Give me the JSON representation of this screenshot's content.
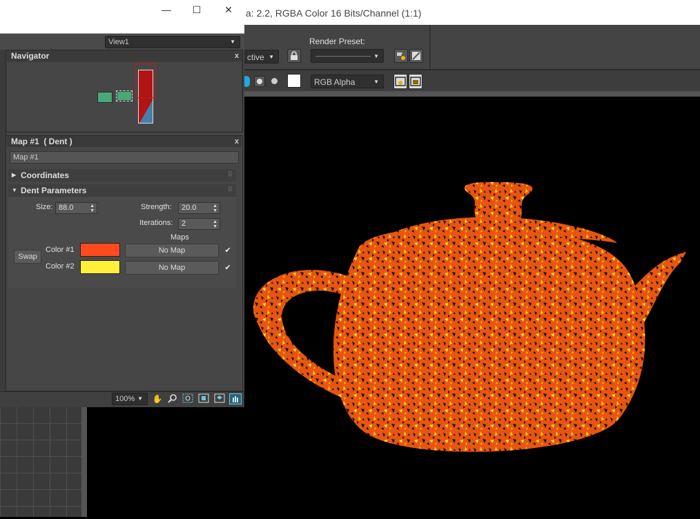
{
  "render_frame": {
    "title_fragment": "a: 2.2, RGBA Color 16 Bits/Channel (1:1)",
    "render_preset_label": "Render Preset:",
    "area_dropdown_value": "ctive",
    "render_preset_value": "",
    "channel_dropdown_value": "RGB Alpha"
  },
  "material_editor": {
    "window_controls": {
      "minimize": "—",
      "maximize": "☐",
      "close": "✕"
    },
    "view_dropdown": "View1",
    "navigator": {
      "title": "Navigator",
      "close": "x"
    },
    "map_panel": {
      "title": "Map #1  ( Dent )",
      "close": "x",
      "map_name": "Map #1",
      "coordinates_rollout": "Coordinates",
      "dent_rollout": "Dent Parameters",
      "size_label": "Size:",
      "size_value": "88.0",
      "strength_label": "Strength:",
      "strength_value": "20.0",
      "iterations_label": "Iterations:",
      "iterations_value": "2",
      "maps_label": "Maps",
      "swap_label": "Swap",
      "color1_label": "Color #1",
      "color1": "#ff4a1e",
      "color2_label": "Color #2",
      "color2": "#ffef3a",
      "map1_button": "No Map",
      "map2_button": "No Map",
      "map1_enabled": "✔",
      "map2_enabled": "✔"
    },
    "zoom_value": "100%"
  },
  "icons": [
    "lock-icon",
    "render-setup-icon",
    "environment-icon",
    "pan-hand-icon",
    "zoom-icon",
    "zoom-region-icon",
    "zoom-extents-icon"
  ]
}
